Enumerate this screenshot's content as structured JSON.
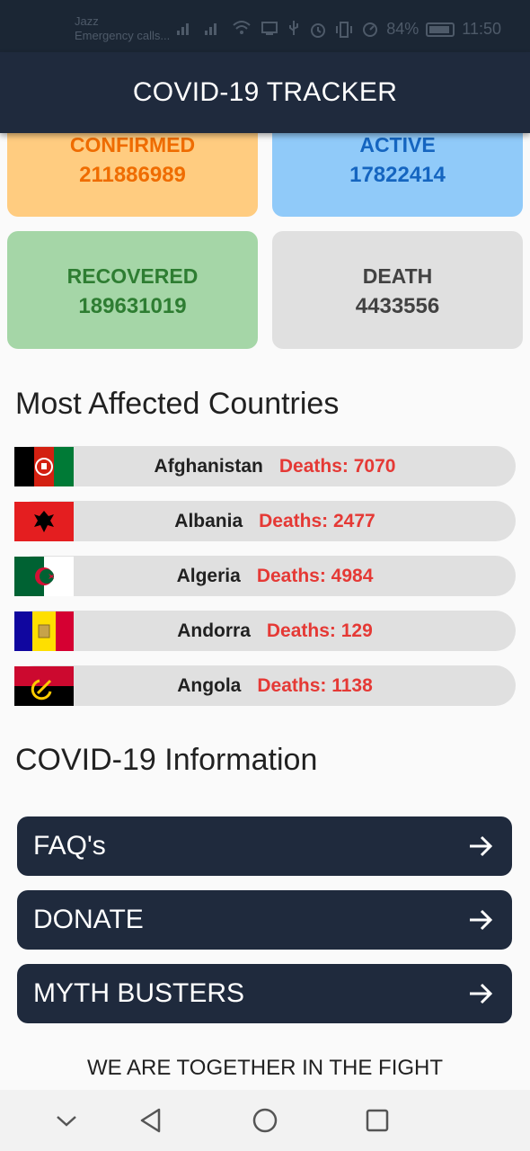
{
  "status_bar": {
    "carrier": "Jazz",
    "carrier_sub": "Emergency calls...",
    "battery": "84%",
    "time": "11:50"
  },
  "app_bar": {
    "title": "COVID-19 TRACKER"
  },
  "stats": {
    "confirmed": {
      "label": "CONFIRMED",
      "value": "211886989"
    },
    "active": {
      "label": "ACTIVE",
      "value": "17822414"
    },
    "recovered": {
      "label": "RECOVERED",
      "value": "189631019"
    },
    "death": {
      "label": "DEATH",
      "value": "4433556"
    }
  },
  "most_affected": {
    "title": "Most Affected Countries",
    "countries": [
      {
        "name": "Afghanistan",
        "deaths": "Deaths: 7070"
      },
      {
        "name": "Albania",
        "deaths": "Deaths: 2477"
      },
      {
        "name": "Algeria",
        "deaths": "Deaths: 4984"
      },
      {
        "name": "Andorra",
        "deaths": "Deaths: 129"
      },
      {
        "name": "Angola",
        "deaths": "Deaths: 1138"
      }
    ]
  },
  "info": {
    "title": "COVID-19 Information",
    "buttons": [
      {
        "label": "FAQ's"
      },
      {
        "label": "DONATE"
      },
      {
        "label": "MYTH BUSTERS"
      }
    ]
  },
  "footer": {
    "text": "WE ARE TOGETHER IN THE FIGHT"
  },
  "colors": {
    "app_bar": "#1f2a3d",
    "confirmed_bg": "#ffcc80",
    "confirmed_text": "#ef6c00",
    "active_bg": "#90caf9",
    "active_text": "#1565c0",
    "recovered_bg": "#a5d6a7",
    "recovered_text": "#2e7d32",
    "death_bg": "#e0e0e0",
    "death_text": "#424242",
    "deaths_red": "#e53935"
  },
  "icons": {
    "status": [
      "signal-icon",
      "wifi-icon",
      "cast-icon",
      "usb-icon",
      "alarm-icon",
      "vibrate-icon",
      "data-saver-icon",
      "battery-icon"
    ],
    "info_button": "arrow-right-icon",
    "nav": [
      "collapse-icon",
      "back-icon",
      "home-icon",
      "recents-icon"
    ]
  }
}
